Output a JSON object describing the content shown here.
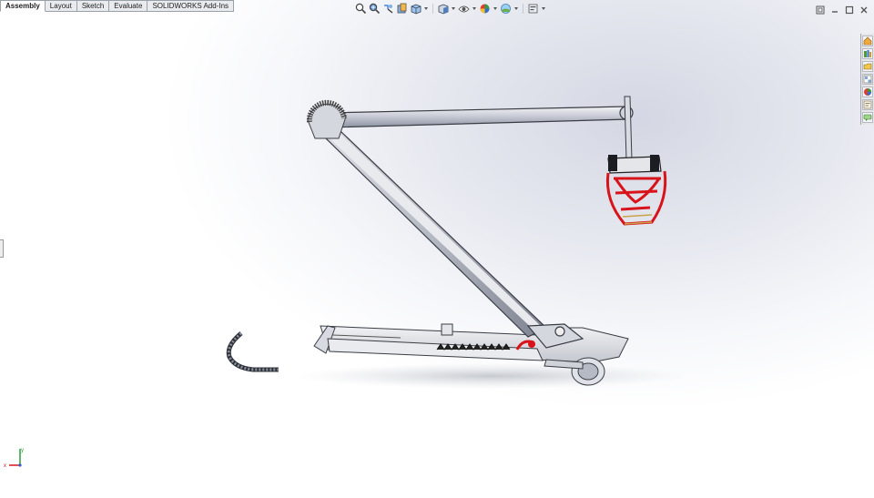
{
  "command_manager": {
    "tabs": [
      {
        "label": "Assembly",
        "active": true
      },
      {
        "label": "Layout",
        "active": false
      },
      {
        "label": "Sketch",
        "active": false
      },
      {
        "label": "Evaluate",
        "active": false
      },
      {
        "label": "SOLIDWORKS Add-Ins",
        "active": false
      }
    ]
  },
  "heads_up_toolbar": {
    "icons": [
      "zoom-to-fit-icon",
      "zoom-to-area-icon",
      "previous-view-icon",
      "section-view-icon",
      "view-orientation-icon",
      "display-style-icon",
      "hide-show-items-icon",
      "edit-appearance-icon",
      "apply-scene-icon",
      "view-settings-icon"
    ]
  },
  "window_controls": [
    "restore-icon",
    "minimize-icon",
    "maximize-icon",
    "close-icon"
  ],
  "task_pane": [
    "solidworks-resources-icon",
    "design-library-icon",
    "file-explorer-icon",
    "view-palette-icon",
    "appearances-icon",
    "custom-properties-icon",
    "forum-icon"
  ],
  "colors": {
    "frame": "#e3e6ea",
    "frame_edge": "#3a3d44",
    "seat_red": "#d8141a",
    "viewport_bg": "#eceef3"
  },
  "triad_axes": {
    "x": "x",
    "y": "y",
    "z": "z"
  }
}
